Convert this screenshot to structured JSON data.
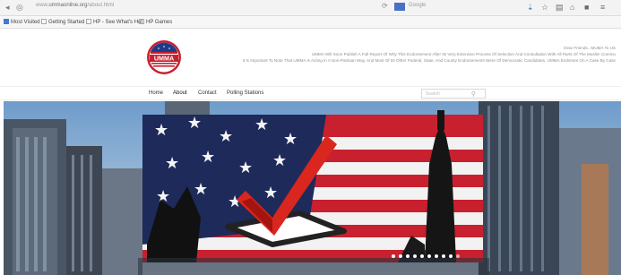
{
  "browser": {
    "back_icon": "back-arrow-icon",
    "url_prefix": "www.",
    "url_domain": "ummaonline.org",
    "url_suffix": "/about.html",
    "reload_glyph": "⟳",
    "search_placeholder": "Google",
    "toolbar_icons": [
      "download-icon",
      "home-icon",
      "bookmark-icon",
      "menu-icon"
    ]
  },
  "bookmarks": [
    {
      "label": "Most Visited",
      "icon": "gear-icon"
    },
    {
      "label": "Getting Started",
      "icon": "page-icon"
    },
    {
      "label": "HP - See What's Hot",
      "icon": "page-icon"
    },
    {
      "label": "HP Games",
      "icon": "page-icon"
    }
  ],
  "site": {
    "logo_text": "UMMA",
    "header_lines": [
      "Dear Friends...MUMA To US",
      "UMMA Will Soon Publish A Full Report Of Why This Endorsement After Its Very Extensive Process Of Selection And Consultation With All Parts Of The Muslim Commu",
      "It Is Important To Note That UMMA Is Acting In A Non-Partisan Way, And Most Of Its Other Federal, State, And County Endorsements Were Of Democratic Candidates. UMMA Endorses On A Case By Case"
    ],
    "nav": [
      {
        "label": "Home"
      },
      {
        "label": "About"
      },
      {
        "label": "Contact"
      },
      {
        "label": "Polling Stations"
      }
    ],
    "search_placeholder": "Search",
    "slider_dot_count": 10,
    "colors": {
      "flag_red": "#c8202e",
      "flag_blue": "#1e2a5a",
      "check_red": "#d9261e"
    }
  }
}
